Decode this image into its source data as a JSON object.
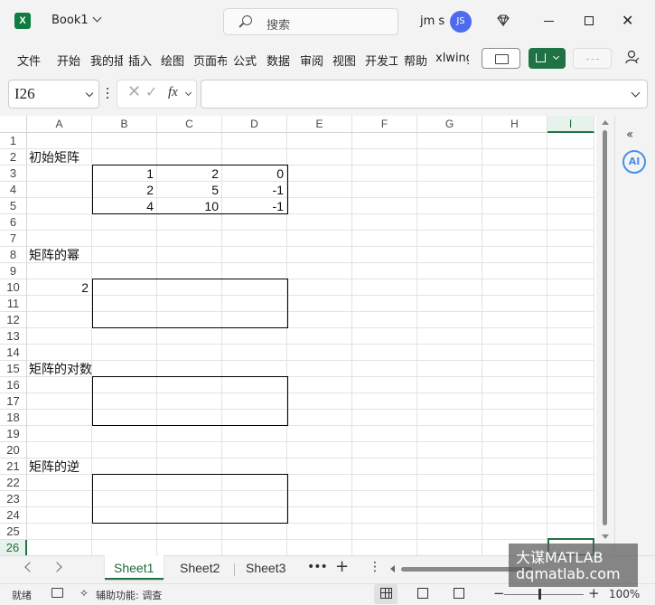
{
  "titlebar": {
    "app_logo": "X",
    "doc_title": "Book1",
    "search_placeholder": "搜索",
    "user_name": "jm s",
    "avatar_initials": "JS"
  },
  "ribbon": {
    "tabs": [
      "文件",
      "开始",
      "我的插",
      "插入",
      "绘图",
      "页面布",
      "公式",
      "数据",
      "审阅",
      "视图",
      "开发工",
      "帮助",
      "xlwing"
    ]
  },
  "formula_bar": {
    "name_box": "I26",
    "fx_label": "fx",
    "formula": ""
  },
  "grid": {
    "columns": [
      "A",
      "B",
      "C",
      "D",
      "E",
      "F",
      "G",
      "H",
      "I"
    ],
    "selected_column": "I",
    "rows": [
      "1",
      "2",
      "3",
      "4",
      "5",
      "6",
      "7",
      "8",
      "9",
      "10",
      "11",
      "12",
      "13",
      "14",
      "15",
      "16",
      "17",
      "18",
      "19",
      "20",
      "21",
      "22",
      "23",
      "24",
      "25",
      "26"
    ],
    "selected_row": "26",
    "selected_cell": "I26",
    "cells": {
      "A2": "初始矩阵",
      "B3": "1",
      "C3": "2",
      "D3": "0",
      "B4": "2",
      "C4": "5",
      "D4": "-1",
      "B5": "4",
      "C5": "10",
      "D5": "-1",
      "A8": "矩阵的幂",
      "A10": "2",
      "A15": "矩阵的对数",
      "A21": "矩阵的逆"
    }
  },
  "side_panel": {
    "collapse_glyph": "‹‹",
    "ai_label": "AI"
  },
  "sheets": {
    "tabs": [
      "Sheet1",
      "Sheet2",
      "Sheet3"
    ],
    "active": "Sheet1"
  },
  "statusbar": {
    "ready": "就绪",
    "accessibility": "辅助功能: 调查",
    "zoom": "100%"
  },
  "watermark": {
    "line1": "大谋MATLAB",
    "line2": "dqmatlab.com"
  },
  "colors": {
    "excel_green": "#217346",
    "share_green": "#1f7244",
    "avatar_blue": "#4f6bed"
  }
}
